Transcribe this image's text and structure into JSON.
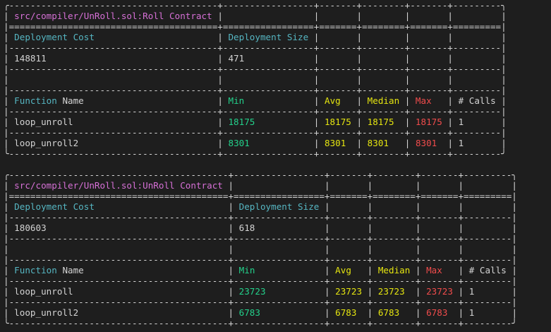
{
  "colors": {
    "background": "#1e1e1e",
    "text": "#d4d4d4",
    "contract_header": "#d670d6",
    "column_header": "#56b6c2",
    "min": "#23d18b",
    "avg_median": "#e5e510",
    "max": "#f14c4c"
  },
  "reports": [
    {
      "contract": "src/compiler/UnRoll.sol:Roll Contract",
      "deployment_cost_label": "Deployment Cost",
      "deployment_size_label": "Deployment Size",
      "deployment_cost": "148811",
      "deployment_size": "471",
      "columns": {
        "function": "Function",
        "name": "Name",
        "min": "Min",
        "avg": "Avg",
        "median": "Median",
        "max": "Max",
        "calls": "# Calls"
      },
      "rows": [
        {
          "function": "loop_unroll",
          "min": "18175",
          "avg": "18175",
          "median": "18175",
          "max": "18175",
          "calls": "1"
        },
        {
          "function": "loop_unroll2",
          "min": "8301",
          "avg": "8301",
          "median": "8301",
          "max": "8301",
          "calls": "1"
        }
      ]
    },
    {
      "contract": "src/compiler/UnRoll.sol:UnRoll Contract",
      "deployment_cost_label": "Deployment Cost",
      "deployment_size_label": "Deployment Size",
      "deployment_cost": "180603",
      "deployment_size": "618",
      "columns": {
        "function": "Function",
        "name": "Name",
        "min": "Min",
        "avg": "Avg",
        "median": "Median",
        "max": "Max",
        "calls": "# Calls"
      },
      "rows": [
        {
          "function": "loop_unroll",
          "min": "23723",
          "avg": "23723",
          "median": "23723",
          "max": "23723",
          "calls": "1"
        },
        {
          "function": "loop_unroll2",
          "min": "6783",
          "avg": "6783",
          "median": "6783",
          "max": "6783",
          "calls": "1"
        }
      ]
    }
  ]
}
